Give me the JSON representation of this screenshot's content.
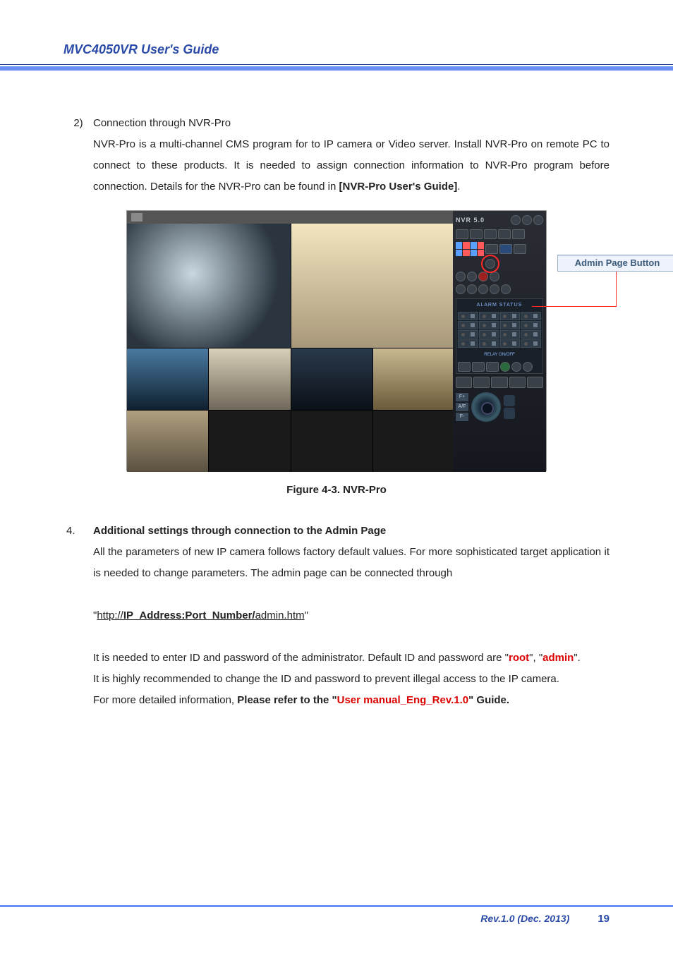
{
  "header": {
    "title": "MVC4050VR User's Guide"
  },
  "body": {
    "item2": {
      "num": "2)",
      "title": "Connection through NVR-Pro",
      "para": "NVR-Pro is a multi-channel CMS program for to IP camera or Video server. Install NVR-Pro on remote PC to connect to these products. It is needed to assign connection information to NVR-Pro program before connection. Details for the NVR-Pro can be found in ",
      "ref": "[NVR-Pro User's Guide]",
      "period": "."
    },
    "figure": {
      "caption": "Figure 4-3. NVR-Pro",
      "nvr_label": "NVR 5.0",
      "alarm_title": "ALARM STATUS",
      "relay_title": "RELAY ON/OFF",
      "ptz_f_plus": "F+",
      "ptz_af": "A/F",
      "ptz_f_minus": "F-",
      "callout": "Admin Page Button"
    },
    "item4": {
      "num": "4.",
      "heading": "Additional settings through connection to the Admin Page",
      "para": "All the parameters of new IP camera follows factory default values. For more sophisticated target application it is needed to change parameters. The admin page can be connected through",
      "url_q1": "\"",
      "url_prefix": "http://",
      "url_bold": "IP_Address:Port_Number/",
      "url_suffix": "admin.htm",
      "url_q2": "\"",
      "p3_a": "It is needed to enter ID and password of the administrator. Default ID and password are \"",
      "p3_root": "root",
      "p3_b": "\", \"",
      "p3_admin": "admin",
      "p3_c": "\".",
      "p4": "It is highly recommended to change the ID and password to prevent illegal access to the IP camera.",
      "p5_a": "For more detailed information, ",
      "p5_b": "Please refer to the ",
      "p5_q1": "\"",
      "p5_ref": "User manual_Eng_Rev.1.0",
      "p5_q2": "\"",
      "p5_c": " Guide."
    }
  },
  "footer": {
    "rev": "Rev.1.0 (Dec. 2013)",
    "page": "19"
  }
}
